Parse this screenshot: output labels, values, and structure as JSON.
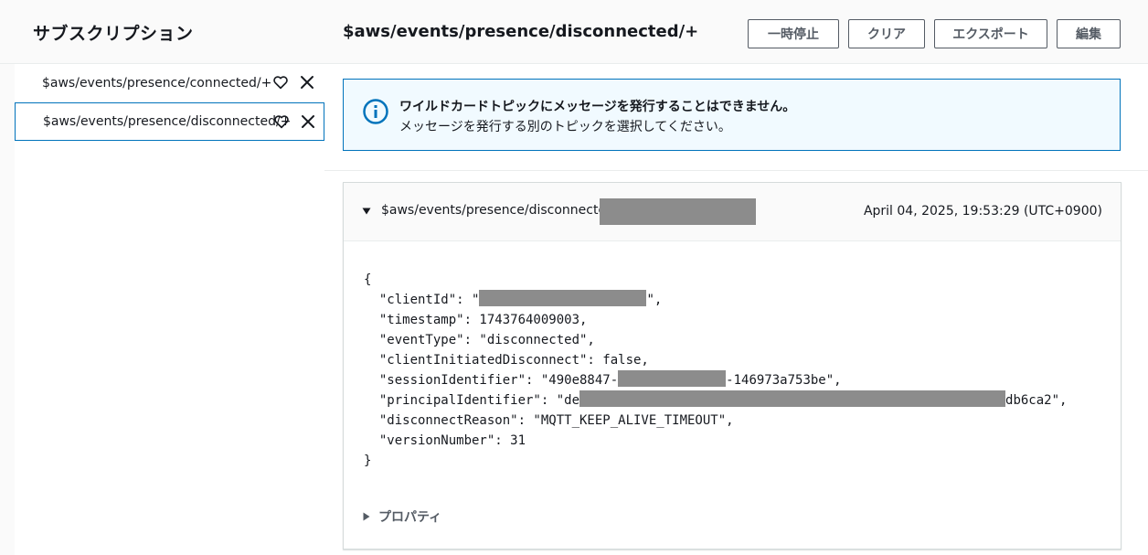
{
  "sidebar": {
    "title": "サブスクリプション",
    "items": [
      {
        "label": "$aws/events/presence/connected/+",
        "selected": false
      },
      {
        "label": "$aws/events/presence/disconnected/+",
        "selected": true
      }
    ]
  },
  "header": {
    "topic_title": "$aws/events/presence/disconnected/+",
    "buttons": {
      "pause": "一時停止",
      "clear": "クリア",
      "export": "エクスポート",
      "edit": "編集"
    }
  },
  "info": {
    "title": "ワイルドカードトピックにメッセージを発行することはできません。",
    "body": "メッセージを発行する別のトピックを選択してください。",
    "color": "#0073bb"
  },
  "message": {
    "topic_prefix": "$aws/events/presence/disconnected/",
    "timestamp": "April 04, 2025, 19:53:29 (UTC+0900)",
    "json_lines": {
      "open": "{",
      "l1_a": "  \"clientId\": \"",
      "l1_b": "\",",
      "l2": "  \"timestamp\": 1743764009003,",
      "l3": "  \"eventType\": \"disconnected\",",
      "l4": "  \"clientInitiatedDisconnect\": false,",
      "l5_a": "  \"sessionIdentifier\": \"490e8847-",
      "l5_b": "-146973a753be\",",
      "l6_a": "  \"principalIdentifier\": \"de",
      "l6_b": "db6ca2\",",
      "l7": "  \"disconnectReason\": \"MQTT_KEEP_ALIVE_TIMEOUT\",",
      "l8": "  \"versionNumber\": 31",
      "close": "}"
    },
    "properties_label": "プロパティ"
  }
}
